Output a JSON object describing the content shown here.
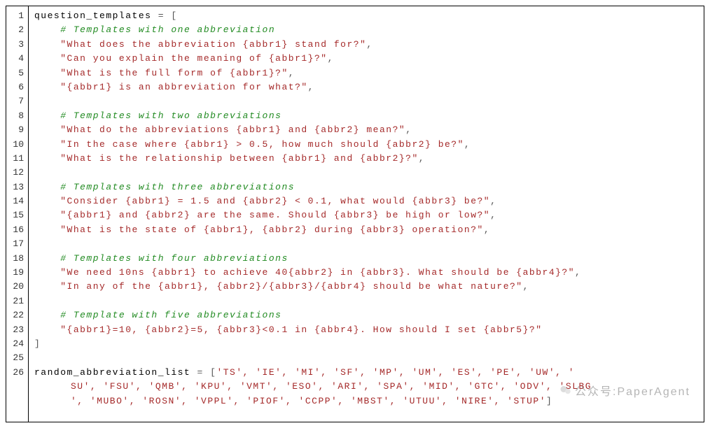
{
  "code": {
    "line_numbers": [
      "1",
      "2",
      "3",
      "4",
      "5",
      "6",
      "7",
      "8",
      "9",
      "10",
      "11",
      "12",
      "13",
      "14",
      "15",
      "16",
      "17",
      "18",
      "19",
      "20",
      "21",
      "22",
      "23",
      "24",
      "25",
      "26"
    ],
    "l1_a": "question_templates ",
    "l1_b": "= [",
    "l2_indent": "    ",
    "l2_comment": "# Templates with one abbreviation",
    "l3_indent": "    ",
    "l3_str": "\"What does the abbreviation {abbr1} stand for?\"",
    "l3_comma": ",",
    "l4_indent": "    ",
    "l4_str": "\"Can you explain the meaning of {abbr1}?\"",
    "l4_comma": ",",
    "l5_indent": "    ",
    "l5_str": "\"What is the full form of {abbr1}?\"",
    "l5_comma": ",",
    "l6_indent": "    ",
    "l6_str": "\"{abbr1} is an abbreviation for what?\"",
    "l6_comma": ",",
    "l7_blank": "",
    "l8_indent": "    ",
    "l8_comment": "# Templates with two abbreviations",
    "l9_indent": "    ",
    "l9_str": "\"What do the abbreviations {abbr1} and {abbr2} mean?\"",
    "l9_comma": ",",
    "l10_indent": "    ",
    "l10_str": "\"In the case where {abbr1} > 0.5, how much should {abbr2} be?\"",
    "l10_comma": ",",
    "l11_indent": "    ",
    "l11_str": "\"What is the relationship between {abbr1} and {abbr2}?\"",
    "l11_comma": ",",
    "l12_blank": "",
    "l13_indent": "    ",
    "l13_comment": "# Templates with three abbreviations",
    "l14_indent": "    ",
    "l14_str": "\"Consider {abbr1} = 1.5 and {abbr2} < 0.1, what would {abbr3} be?\"",
    "l14_comma": ",",
    "l15_indent": "    ",
    "l15_str": "\"{abbr1} and {abbr2} are the same. Should {abbr3} be high or low?\"",
    "l15_comma": ",",
    "l16_indent": "    ",
    "l16_str": "\"What is the state of {abbr1}, {abbr2} during {abbr3} operation?\"",
    "l16_comma": ",",
    "l17_blank": "",
    "l18_indent": "    ",
    "l18_comment": "# Templates with four abbreviations",
    "l19_indent": "    ",
    "l19_str": "\"We need 10ns {abbr1} to achieve 40{abbr2} in {abbr3}. What should be {abbr4}?\"",
    "l19_comma": ",",
    "l20_indent": "    ",
    "l20_str": "\"In any of the {abbr1}, {abbr2}/{abbr3}/{abbr4} should be what nature?\"",
    "l20_comma": ",",
    "l21_blank": "",
    "l22_indent": "    ",
    "l22_comment": "# Template with five abbreviations",
    "l23_indent": "    ",
    "l23_str": "\"{abbr1}=10, {abbr2}=5, {abbr3}<0.1 in {abbr4}. How should I set {abbr5}?\"",
    "l24_close": "]",
    "l25_blank": "",
    "l26_a": "random_abbreviation_list ",
    "l26_b": "= [",
    "l26_list_line1": "'TS', 'IE', 'MI', 'SF', 'MP', 'UM', 'ES', 'PE', 'UW', '",
    "l26_list_line2": "SU', 'FSU', 'QMB', 'KPU', 'VMT', 'ESO', 'ARI', 'SPA', 'MID', 'GTC', 'ODV', 'SLBG",
    "l26_list_line3": "', 'MUBO', 'ROSN', 'VPPL', 'PIOF', 'CCPP', 'MBST', 'UTUU', 'NIRE', 'STUP'",
    "l26_end": "]"
  },
  "watermark": {
    "text": "公众号:PaperAgent"
  }
}
